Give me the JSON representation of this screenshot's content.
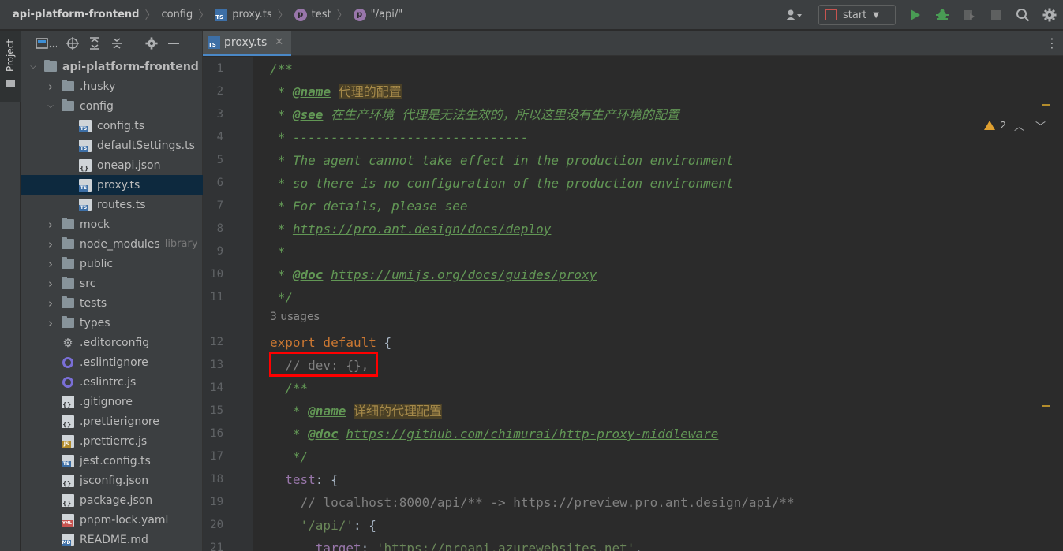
{
  "breadcrumb": {
    "project": "api-platform-frontend",
    "folder": "config",
    "file": "proxy.ts",
    "prop1": "test",
    "prop2": "\"/api/\"",
    "p_letter": "p",
    "ts_letters": "TS"
  },
  "toolbar": {
    "run_config": "start"
  },
  "stripe": {
    "label": "Project"
  },
  "tab": {
    "label": "proxy.ts",
    "close": "✕"
  },
  "tree": [
    {
      "label": "api-platform-frontend",
      "kind": "folder",
      "open": true,
      "level": 0,
      "bold": true
    },
    {
      "label": ".husky",
      "kind": "folder",
      "open": false,
      "level": 1
    },
    {
      "label": "config",
      "kind": "folder",
      "open": true,
      "level": 1
    },
    {
      "label": "config.ts",
      "kind": "ts",
      "level": 2
    },
    {
      "label": "defaultSettings.ts",
      "kind": "ts",
      "level": 2
    },
    {
      "label": "oneapi.json",
      "kind": "json",
      "level": 2
    },
    {
      "label": "proxy.ts",
      "kind": "ts",
      "level": 2,
      "selected": true
    },
    {
      "label": "routes.ts",
      "kind": "ts",
      "level": 2
    },
    {
      "label": "mock",
      "kind": "folder",
      "open": false,
      "level": 1
    },
    {
      "label": "node_modules",
      "kind": "folder",
      "open": false,
      "level": 1,
      "tag": "library"
    },
    {
      "label": "public",
      "kind": "folder",
      "open": false,
      "level": 1
    },
    {
      "label": "src",
      "kind": "folder",
      "open": false,
      "level": 1
    },
    {
      "label": "tests",
      "kind": "folder",
      "open": false,
      "level": 1
    },
    {
      "label": "types",
      "kind": "folder",
      "open": false,
      "level": 1
    },
    {
      "label": ".editorconfig",
      "kind": "gear",
      "level": 1
    },
    {
      "label": ".eslintignore",
      "kind": "ring",
      "level": 1
    },
    {
      "label": ".eslintrc.js",
      "kind": "ring",
      "level": 1
    },
    {
      "label": ".gitignore",
      "kind": "json",
      "level": 1
    },
    {
      "label": ".prettierignore",
      "kind": "json",
      "level": 1
    },
    {
      "label": ".prettierrc.js",
      "kind": "js",
      "level": 1
    },
    {
      "label": "jest.config.ts",
      "kind": "ts",
      "level": 1
    },
    {
      "label": "jsconfig.json",
      "kind": "json",
      "level": 1
    },
    {
      "label": "package.json",
      "kind": "json",
      "level": 1
    },
    {
      "label": "pnpm-lock.yaml",
      "kind": "yml",
      "level": 1
    },
    {
      "label": "README.md",
      "kind": "md",
      "level": 1
    }
  ],
  "usages": "3 usages",
  "warnings": {
    "count": "2"
  },
  "lines": [
    {
      "n": "1",
      "parts": [
        [
          "c-doc",
          "/**"
        ]
      ]
    },
    {
      "n": "2",
      "parts": [
        [
          "c-doc",
          " * "
        ],
        [
          "c-tag",
          "@name"
        ],
        [
          "c-doc",
          " "
        ],
        [
          "c-tagval",
          "代理的配置"
        ]
      ]
    },
    {
      "n": "3",
      "parts": [
        [
          "c-doc",
          " * "
        ],
        [
          "c-tag",
          "@see"
        ],
        [
          "c-doc",
          " 在生产环境 代理是无法生效的，所以这里没有生产环境的配置"
        ]
      ]
    },
    {
      "n": "4",
      "parts": [
        [
          "c-doc",
          " * -------------------------------"
        ]
      ]
    },
    {
      "n": "5",
      "parts": [
        [
          "c-doc",
          " * The agent cannot take effect in the production environment"
        ]
      ]
    },
    {
      "n": "6",
      "parts": [
        [
          "c-doc",
          " * so there is no configuration of the production environment"
        ]
      ]
    },
    {
      "n": "7",
      "parts": [
        [
          "c-doc",
          " * For details, please see"
        ]
      ]
    },
    {
      "n": "8",
      "parts": [
        [
          "c-doc",
          " * "
        ],
        [
          "c-link",
          "https://pro.ant.design/docs/deploy"
        ]
      ]
    },
    {
      "n": "9",
      "parts": [
        [
          "c-doc",
          " *"
        ]
      ]
    },
    {
      "n": "10",
      "parts": [
        [
          "c-doc",
          " * "
        ],
        [
          "c-tag",
          "@doc"
        ],
        [
          "c-doc",
          " "
        ],
        [
          "c-link",
          "https://umijs.org/docs/guides/proxy"
        ]
      ]
    },
    {
      "n": "11",
      "parts": [
        [
          "c-doc",
          " */"
        ]
      ]
    },
    {
      "n": "12",
      "parts": [
        [
          "kw",
          "export default"
        ],
        [
          "",
          " {"
        ]
      ]
    },
    {
      "n": "13",
      "parts": [
        [
          "c-cmt",
          "  // dev: {},"
        ]
      ]
    },
    {
      "n": "14",
      "parts": [
        [
          "c-doc",
          "  /**"
        ]
      ]
    },
    {
      "n": "15",
      "parts": [
        [
          "c-doc",
          "   * "
        ],
        [
          "c-tag",
          "@name"
        ],
        [
          "c-doc",
          " "
        ],
        [
          "c-tagval",
          "详细的代理配置"
        ]
      ]
    },
    {
      "n": "16",
      "parts": [
        [
          "c-doc",
          "   * "
        ],
        [
          "c-tag",
          "@doc"
        ],
        [
          "c-doc",
          " "
        ],
        [
          "c-link",
          "https://github.com/chimurai/http-proxy-middleware"
        ]
      ]
    },
    {
      "n": "17",
      "parts": [
        [
          "c-doc",
          "   */"
        ]
      ]
    },
    {
      "n": "18",
      "parts": [
        [
          "prop",
          "  test"
        ],
        [
          "",
          ": {"
        ]
      ]
    },
    {
      "n": "19",
      "parts": [
        [
          "c-cmt",
          "    // localhost:8000/api/** -> "
        ],
        [
          "c-cmt-link",
          "https://preview.pro.ant.design/api/"
        ],
        [
          "c-cmt",
          "**"
        ]
      ]
    },
    {
      "n": "20",
      "parts": [
        [
          "str",
          "    '/api/'"
        ],
        [
          "",
          ": {"
        ]
      ]
    },
    {
      "n": "21",
      "parts": [
        [
          "prop",
          "      target"
        ],
        [
          "",
          ": "
        ],
        [
          "str",
          "'https://proapi.azurewebsites.net'"
        ],
        [
          "",
          ","
        ]
      ]
    }
  ]
}
